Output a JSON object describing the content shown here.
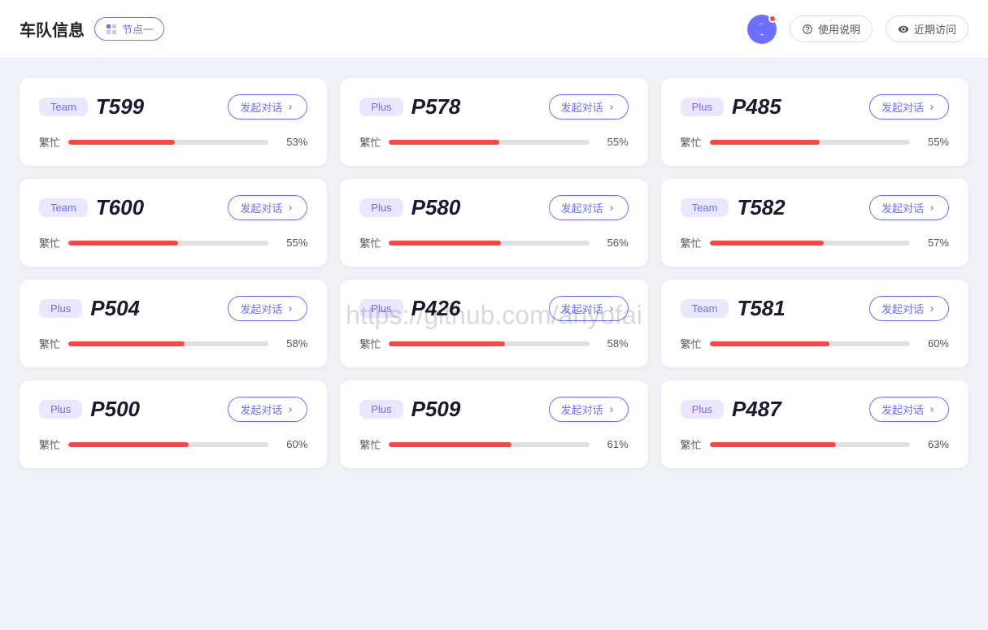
{
  "header": {
    "title": "车队信息",
    "node_label": "节点一",
    "alert_label": "alert",
    "help_label": "使用说明",
    "recent_label": "近期访问"
  },
  "cards": [
    {
      "tag": "Team",
      "tag_type": "team",
      "id": "T599",
      "btn": "发起对话",
      "busy_label": "繁忙",
      "pct": 53
    },
    {
      "tag": "Plus",
      "tag_type": "plus",
      "id": "P578",
      "btn": "发起对话",
      "busy_label": "繁忙",
      "pct": 55
    },
    {
      "tag": "Plus",
      "tag_type": "plus",
      "id": "P485",
      "btn": "发起对话",
      "busy_label": "繁忙",
      "pct": 55
    },
    {
      "tag": "Team",
      "tag_type": "team",
      "id": "T600",
      "btn": "发起对话",
      "busy_label": "繁忙",
      "pct": 55
    },
    {
      "tag": "Plus",
      "tag_type": "plus",
      "id": "P580",
      "btn": "发起对话",
      "busy_label": "繁忙",
      "pct": 56
    },
    {
      "tag": "Team",
      "tag_type": "team",
      "id": "T582",
      "btn": "发起对话",
      "busy_label": "繁忙",
      "pct": 57
    },
    {
      "tag": "Plus",
      "tag_type": "plus",
      "id": "P504",
      "btn": "发起对话",
      "busy_label": "繁忙",
      "pct": 58
    },
    {
      "tag": "Plus",
      "tag_type": "plus",
      "id": "P426",
      "btn": "发起对话",
      "busy_label": "繁忙",
      "pct": 58
    },
    {
      "tag": "Team",
      "tag_type": "team",
      "id": "T581",
      "btn": "发起对话",
      "busy_label": "繁忙",
      "pct": 60
    },
    {
      "tag": "Plus",
      "tag_type": "plus",
      "id": "P500",
      "btn": "发起对话",
      "busy_label": "繁忙",
      "pct": 60
    },
    {
      "tag": "Plus",
      "tag_type": "plus",
      "id": "P509",
      "btn": "发起对话",
      "busy_label": "繁忙",
      "pct": 61
    },
    {
      "tag": "Plus",
      "tag_type": "plus",
      "id": "P487",
      "btn": "发起对话",
      "busy_label": "繁忙",
      "pct": 63
    }
  ],
  "watermark": "https://github.com/anyofai"
}
